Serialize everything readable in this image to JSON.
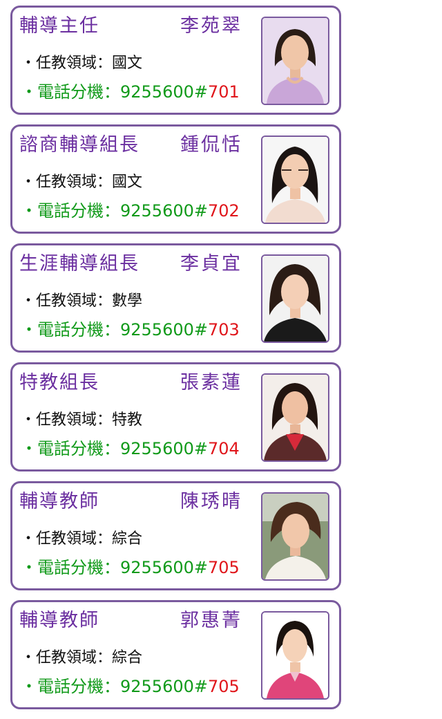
{
  "staff": [
    {
      "title": "輔導主任",
      "name": "李苑翠",
      "subject_label": "・任教領域：",
      "subject": "國文",
      "phone_label": "・電話分機：",
      "phone_main": "9255600#",
      "phone_ext": "701"
    },
    {
      "title": "諮商輔導組長",
      "name": "鍾侃恬",
      "subject_label": "・任教領域：",
      "subject": "國文",
      "phone_label": "・電話分機：",
      "phone_main": "9255600#",
      "phone_ext": "702"
    },
    {
      "title": "生涯輔導組長",
      "name": "李貞宜",
      "subject_label": "・任教領域：",
      "subject": "數學",
      "phone_label": "・電話分機：",
      "phone_main": "9255600#",
      "phone_ext": "703"
    },
    {
      "title": "特教組長",
      "name": "張素蓮",
      "subject_label": "・任教領域：",
      "subject": "特教",
      "phone_label": "・電話分機：",
      "phone_main": "9255600#",
      "phone_ext": "704"
    },
    {
      "title": "輔導教師",
      "name": "陳琇晴",
      "subject_label": "・任教領域：",
      "subject": "綜合",
      "phone_label": "・電話分機：",
      "phone_main": "9255600#",
      "phone_ext": "705"
    },
    {
      "title": "輔導教師",
      "name": "郭惠菁",
      "subject_label": "・任教領域：",
      "subject": "綜合",
      "phone_label": "・電話分機：",
      "phone_main": "9255600#",
      "phone_ext": "705"
    }
  ],
  "colors": {
    "title": "#6b2fa0",
    "border": "#7a5a9e",
    "phone": "#119a1a",
    "extension": "#e0161b",
    "subject": "#111111"
  }
}
